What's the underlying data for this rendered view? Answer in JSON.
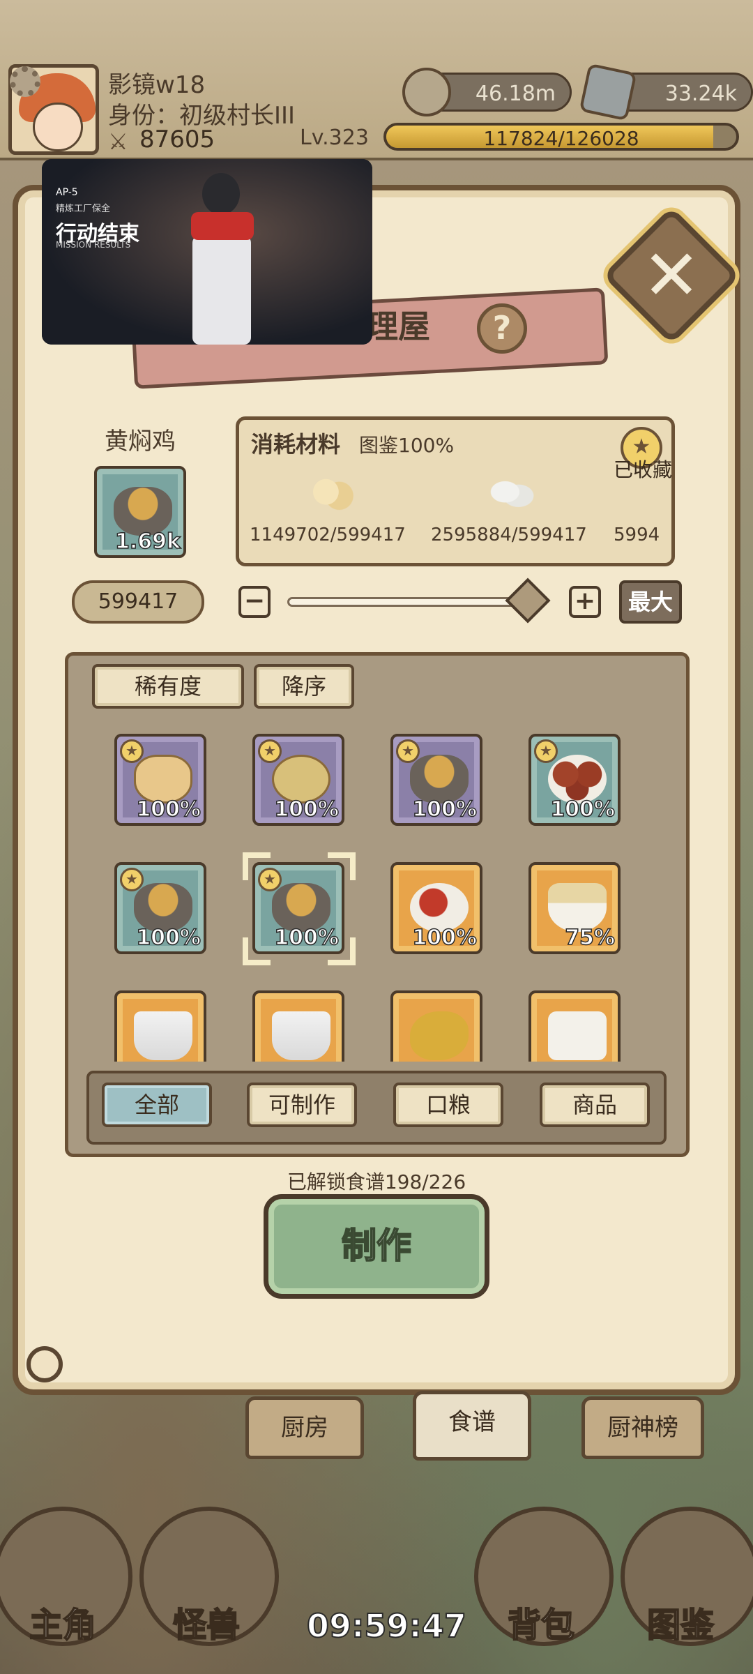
{
  "player": {
    "name": "影镜w18",
    "title": "身份：初级村长III",
    "power": "87605",
    "level": "Lv.323",
    "exp_text": "117824/126028",
    "exp_progress": 0.935
  },
  "currency": {
    "coin": "46.18m",
    "stone": "33.24k"
  },
  "pip": {
    "code": "AP-5",
    "subtitle": "精炼工厂保全",
    "title": "行动结束",
    "mission": "MISSION RESULTS"
  },
  "panel": {
    "title_partial": "理屋",
    "help": "?",
    "close": "✕"
  },
  "dish": {
    "name": "黄焖鸡",
    "count": "1.69k"
  },
  "materials": {
    "title": "消耗材料",
    "codex": "图鉴100%",
    "favorite": "已收藏",
    "items": [
      {
        "icon": "flour-icon",
        "value": "1149702/599417"
      },
      {
        "icon": "egg-icon",
        "value": "2595884/599417"
      },
      {
        "icon": "third-material",
        "value": "5994"
      }
    ]
  },
  "quantity": {
    "value": "599417",
    "minus": "−",
    "plus": "+",
    "max": "最大",
    "slider_level": 1.0
  },
  "sort": {
    "rarity": "稀有度",
    "order": "降序"
  },
  "recipes": [
    {
      "food": "bread",
      "frame": "purple",
      "pct": "100%",
      "star": true
    },
    {
      "food": "pancake",
      "frame": "purple",
      "pct": "100%",
      "star": true
    },
    {
      "food": "pot",
      "frame": "purple",
      "pct": "100%",
      "star": true
    },
    {
      "food": "meat",
      "frame": "teal",
      "pct": "100%",
      "star": true
    },
    {
      "food": "pot",
      "frame": "teal",
      "pct": "100%",
      "star": true
    },
    {
      "food": "pot",
      "frame": "teal",
      "pct": "100%",
      "star": true,
      "selected": true
    },
    {
      "food": "tomato",
      "frame": "gold",
      "pct": "100%",
      "star": false
    },
    {
      "food": "bowl",
      "frame": "gold",
      "pct": "75%",
      "star": false
    },
    {
      "food": "drink",
      "frame": "gold",
      "pct": "",
      "star": false
    },
    {
      "food": "drink",
      "frame": "gold",
      "pct": "",
      "star": false
    },
    {
      "food": "chicken",
      "frame": "gold",
      "pct": "",
      "star": false
    },
    {
      "food": "cup",
      "frame": "gold",
      "pct": "",
      "star": false
    }
  ],
  "filters": {
    "all": "全部",
    "craftable": "可制作",
    "ration": "口粮",
    "goods": "商品"
  },
  "unlocked": "已解锁食谱198/226",
  "make_button": "制作",
  "tabs": {
    "kitchen": "厨房",
    "recipe": "食谱",
    "rank": "厨神榜"
  },
  "nav": {
    "hero": "主角",
    "monster": "怪兽",
    "bag": "背包",
    "codex": "图鉴"
  },
  "clock": "09:59:47"
}
